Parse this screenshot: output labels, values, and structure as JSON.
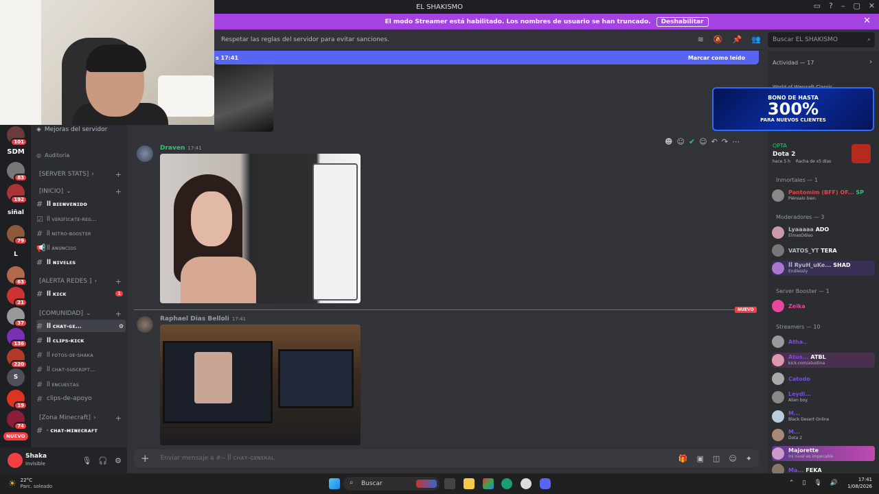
{
  "window": {
    "title": "EL SHAKISMO"
  },
  "streamer": {
    "message": "El modo Streamer está habilitado. Los nombres de usuario se han truncado.",
    "button": "Deshabilitar"
  },
  "header": {
    "topic": "Respetar las reglas del servidor para evitar sanciones.",
    "search_placeholder": "Buscar EL SHAKISMO"
  },
  "newbar": {
    "time": "s 17:41",
    "action": "Marcar como leído"
  },
  "servers": {
    "labels": [
      "SDM",
      "siñal",
      "L",
      "S"
    ],
    "badges": [
      "101",
      "83",
      "192",
      "79",
      "63",
      "21",
      "37",
      "136",
      "220",
      "19",
      "74"
    ],
    "new_label": "NUEVO"
  },
  "channels": {
    "boost": "Mejoras del servidor",
    "audit": "Auditoría",
    "cat_stats": "[SERVER STATS]",
    "cat_inicio": "[INICIO]",
    "cat_alerta": "[ALERTA REDES ]",
    "cat_comunidad": "[COMUNIDAD]",
    "cat_minecraft": "[Zona Minecraft]",
    "items": [
      "ꟾꟾ ʙɪᴇɴᴠᴇɴɪᴅᴏ",
      "ꟾꟾ ᴠᴇʀɪꜰɪᴄᴀᴛᴇ-ʀᴇɢ...",
      "ꟾꟾ ɴɪᴛʀᴏ-ʙᴏᴏꜱᴛᴇʀ",
      "ꟾꟾ ᴀɴᴜɴᴄɪᴏꜱ",
      "ꟾꟾ ɴɪᴠᴇʟᴇꜱ",
      "ꟾꟾ ᴋɪᴄᴋ",
      "ꟾꟾ ᴄʜᴀᴛ-ɢᴇ...",
      "ꟾꟾ ᴄʟɪᴘꜱ-ᴋɪᴄᴋ",
      "ꟾꟾ ꜰᴏᴛᴏꜱ-ᴅᴇ-ꜱʜᴀᴋᴀ",
      "ꟾꟾ ᴄʜᴀᴛ-ꜱᴜꜱᴄʀɪᴘᴛ...",
      "ꟾꟾ ᴇɴᴄᴜᴇꜱᴛᴀꜱ",
      "clips-de-apoyo",
      "ᐧ ᴄʜᴀᴛ-ᴍɪɴᴇᴄʀᴀꜰᴛ"
    ],
    "kick_badge": "1"
  },
  "user": {
    "name": "Shaka",
    "status": "Invisible"
  },
  "messages": [
    {
      "author": "Draven",
      "time": "17:41",
      "color": "#2dc770"
    },
    {
      "author": "Raphael Dias Belloli",
      "time": "17:41",
      "color": "#949ba4"
    }
  ],
  "divider": {
    "label": "NUEVO"
  },
  "composer": {
    "placeholder": "Enviar mensaje a #-- ꟾꟾ ᴄʜᴀᴛ-ɢᴇɴᴇʀᴀʟ"
  },
  "activity": {
    "title": "Actividad — 17",
    "game1": "World of Warcraft Classic",
    "game2_label": "OPTA",
    "game2": "Dota 2",
    "game2_sub": "hace 5 h",
    "game2_streak": "Racha de x5 días"
  },
  "ad": {
    "line1": "BONO DE HASTA",
    "line2": "300%",
    "line3": "PARA NUEVOS CLIENTES"
  },
  "members": {
    "cat_inmortales": "Inmortales — 1",
    "inmortal": {
      "name": "Pantomim (BFF) OF...",
      "tag": "SP",
      "sub": "Piénsalo bien."
    },
    "cat_moderadores": "Moderadores — 3",
    "mods": [
      {
        "name": "Lyaaaaa",
        "tag": "ADO",
        "sub": "ElmasOdiao"
      },
      {
        "name": "VATOS_YT",
        "tag": "TERA",
        "sub": ""
      },
      {
        "name": "ꟾꟾ RyuH_uKe...",
        "tag": "SHAD",
        "sub": "Endlessly"
      }
    ],
    "cat_booster": "Server Booster — 1",
    "booster": {
      "name": "Zeika"
    },
    "cat_streamers": "Streamers — 10",
    "streamers": [
      {
        "name": "Atha..",
        "tag": "",
        "sub": ""
      },
      {
        "name": "Atus...",
        "tag": "ATBL",
        "sub": "kick.com/atustina"
      },
      {
        "name": "Catodo",
        "tag": "",
        "sub": ""
      },
      {
        "name": "Leydi...",
        "tag": "",
        "sub": "Alien boy."
      },
      {
        "name": "M...",
        "tag": "",
        "sub": "Black Desert Online"
      },
      {
        "name": "M...",
        "tag": "",
        "sub": "Dota 2"
      },
      {
        "name": "Majorette",
        "tag": "",
        "sub": "mi nivel es impecable"
      },
      {
        "name": "Ma...",
        "tag": "FEKA",
        "sub": ""
      }
    ]
  },
  "taskbar": {
    "weather_temp": "22°C",
    "weather_desc": "Parc. soleado",
    "search": "Buscar",
    "time": "17:41",
    "date": "1/08/2026"
  }
}
